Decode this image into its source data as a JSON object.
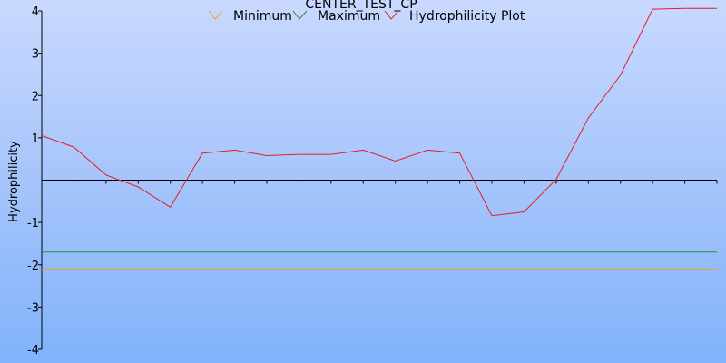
{
  "chart_data": {
    "type": "line",
    "title": "CENTER_TEST_CP",
    "xlabel": "",
    "ylabel": "Hydrophilicity",
    "ylim": [
      -4,
      4
    ],
    "yticks": [
      "-4",
      "-3",
      "-2",
      "-1",
      "1",
      "2",
      "3",
      "4"
    ],
    "x": [
      1,
      2,
      3,
      4,
      5,
      6,
      7,
      8,
      9,
      10,
      11,
      12,
      13,
      14,
      15,
      16,
      17,
      18,
      19,
      20,
      21,
      22
    ],
    "xlim": [
      1,
      22
    ],
    "grid": false,
    "legend_position": "top",
    "series": [
      {
        "name": "Minimum",
        "color": "#f0a020",
        "values": [
          -2.1,
          -2.1,
          -2.1,
          -2.1,
          -2.1,
          -2.1,
          -2.1,
          -2.1,
          -2.1,
          -2.1,
          -2.1,
          -2.1,
          -2.1,
          -2.1,
          -2.1,
          -2.1,
          -2.1,
          -2.1,
          -2.1,
          -2.1,
          -2.1,
          -2.1
        ]
      },
      {
        "name": "Maximum",
        "color": "#2e8b2e",
        "values": [
          -1.7,
          -1.7,
          -1.7,
          -1.7,
          -1.7,
          -1.7,
          -1.7,
          -1.7,
          -1.7,
          -1.7,
          -1.7,
          -1.7,
          -1.7,
          -1.7,
          -1.7,
          -1.7,
          -1.7,
          -1.7,
          -1.7,
          -1.7,
          -1.7,
          -1.7
        ]
      },
      {
        "name": "Hydrophilicity Plot",
        "color": "#e02020",
        "values": [
          1.05,
          0.78,
          0.12,
          -0.16,
          -0.64,
          0.64,
          0.71,
          0.58,
          0.61,
          0.61,
          0.71,
          0.45,
          0.71,
          0.64,
          -0.84,
          -0.75,
          0.02,
          1.47,
          2.48,
          4.04,
          4.06,
          4.06
        ]
      }
    ]
  }
}
